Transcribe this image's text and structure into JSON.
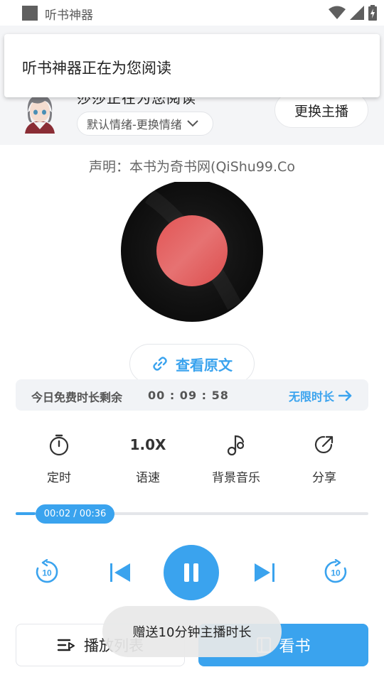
{
  "status_bar": {
    "app_title": "听书神器"
  },
  "header": {
    "hidden_title": "莎莎正在为您阅读",
    "emotion_chip": "默认情绪-更换情绪",
    "change_anchor": "更换主播"
  },
  "notification": {
    "text": "听书神器正在为您阅读"
  },
  "disclaimer": "声明：本书为奇书网(QiShu99.Co",
  "view_original": "查看原文",
  "free_time": {
    "label": "今日免费时长剩余",
    "remaining": "00 : 09 : 58",
    "unlimited": "无限时长"
  },
  "toolbar": {
    "timer": "定时",
    "speed_value": "1.0X",
    "speed": "语速",
    "bg_music": "背景音乐",
    "share": "分享"
  },
  "progress": {
    "label": "00:02 / 00:36",
    "fraction": 0.056
  },
  "controls": {
    "rewind_seconds": "10",
    "forward_seconds": "10"
  },
  "bottom": {
    "playlist": "播放列表",
    "read": "看书"
  },
  "toast": "赠送10分钟主播时长",
  "colors": {
    "accent": "#3aa3ee",
    "record_label": "#e05a5a",
    "record": "#151515"
  },
  "icons": [
    "app-icon",
    "wifi-icon",
    "signal-icon",
    "battery-icon",
    "avatar",
    "chevron-down-icon",
    "link-icon",
    "arrow-right-icon",
    "timer-icon",
    "music-note-icon",
    "share-icon",
    "replay-10-icon",
    "skip-previous-icon",
    "pause-icon",
    "skip-next-icon",
    "forward-10-icon",
    "playlist-icon",
    "book-icon"
  ]
}
